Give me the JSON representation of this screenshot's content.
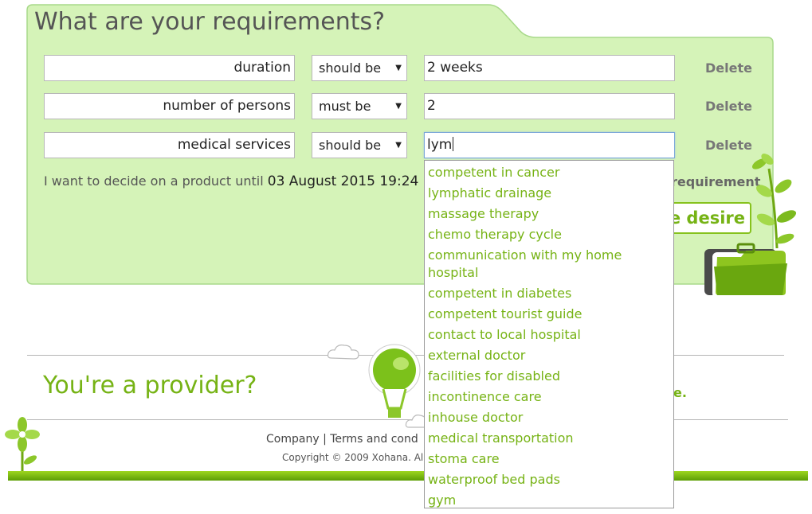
{
  "panel": {
    "title": "What are your requirements?",
    "requirements": [
      {
        "name": "duration",
        "operator": "should be",
        "value": "2 weeks",
        "delete_label": "Delete"
      },
      {
        "name": "number of persons",
        "operator": "must be",
        "value": "2",
        "delete_label": "Delete"
      },
      {
        "name": "medical services",
        "operator": "should be",
        "value": "lym",
        "delete_label": "Delete"
      }
    ],
    "decide_label": "I want to decide on a product until",
    "decide_date": "03 August 2015 19:24",
    "add_requirement_label": "requirement",
    "save_label": "ve desire"
  },
  "provider": {
    "title": "You're a provider?",
    "tail_text": "e."
  },
  "footer": {
    "company_link": "Company",
    "separator": "|",
    "terms_link": "Terms and cond",
    "copyright": "Copyright © 2009 Xohana. Al"
  },
  "autocomplete": {
    "items": [
      "competent in cancer",
      "lymphatic drainage",
      "massage therapy",
      "chemo therapy cycle",
      "communication with my home hospital",
      "competent in diabetes",
      "competent tourist guide",
      "contact to local hospital",
      "external doctor",
      "facilities for disabled",
      "incontinence care",
      "inhouse doctor",
      "medical transportation",
      "stoma care",
      "waterproof bed pads",
      "gym"
    ]
  },
  "colors": {
    "panel_bg": "#d5f3b8",
    "panel_border": "#a8d98a",
    "accent_green": "#76b315",
    "text_gray": "#555555"
  },
  "icons": {
    "dropdown_arrow": "triangle-down",
    "folder": "green-folder-icon",
    "balloon": "hot-air-balloon-icon",
    "cloud": "cloud-icon",
    "leaves": "leaf-sprig-icon",
    "flower": "flower-icon"
  }
}
